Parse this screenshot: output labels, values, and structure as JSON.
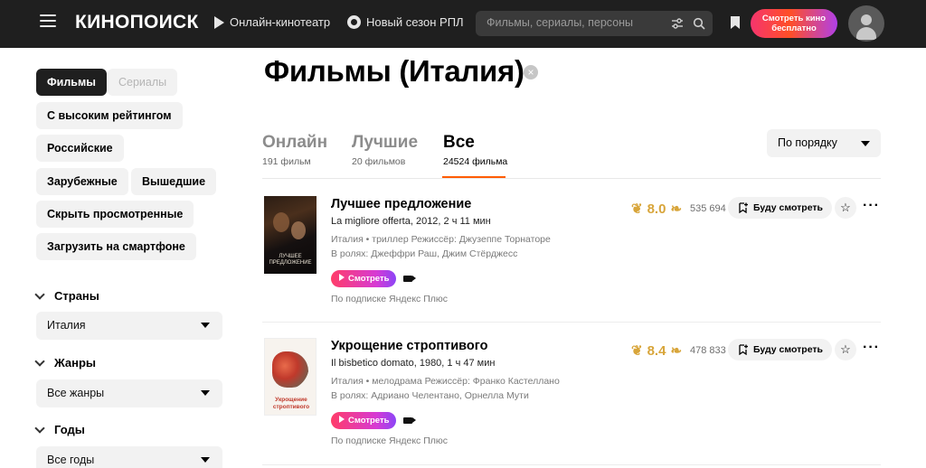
{
  "header": {
    "logo": "КИНОПОИСК",
    "nav": [
      {
        "label": "Онлайн-кинотеатр",
        "icon": "play-icon"
      },
      {
        "label": "Новый сезон РПЛ",
        "icon": "football-icon"
      }
    ],
    "search_placeholder": "Фильмы, сериалы, персоны",
    "cta_label": "Смотреть кино бесплатно",
    "colors": {
      "background": "#1f1f1f",
      "cta_gradient": [
        "#f5356e",
        "#ff4f26",
        "#b040e8"
      ]
    }
  },
  "sidebar": {
    "chips": [
      {
        "label": "Фильмы",
        "state": "active"
      },
      {
        "label": "Сериалы",
        "state": "disabled"
      },
      {
        "label": "С высоким рейтингом"
      },
      {
        "label": "Российские"
      },
      {
        "label": "Зарубежные"
      },
      {
        "label": "Вышедшие"
      },
      {
        "label": "Скрыть просмотренные"
      },
      {
        "label": "Загрузить на смартфоне"
      }
    ],
    "filters": [
      {
        "title": "Страны",
        "value": "Италия"
      },
      {
        "title": "Жанры",
        "value": "Все жанры"
      },
      {
        "title": "Годы",
        "value": "Все годы"
      }
    ]
  },
  "main": {
    "title": "Фильмы (Италия)",
    "tabs": [
      {
        "label": "Онлайн",
        "count": "191 фильм"
      },
      {
        "label": "Лучшие",
        "count": "20 фильмов"
      },
      {
        "label": "Все",
        "count": "24524 фильма",
        "active": true
      }
    ],
    "sort": "По порядку",
    "accent_color": "#ff5c00",
    "films": [
      {
        "title": "Лучшее предложение",
        "original": "La migliore offerta, 2012, 2 ч 11 мин",
        "meta": "Италия • триллер  Режиссёр: Джузеппе Торнаторе",
        "cast": "В ролях: Джеффри Раш, Джим Стёрджесс",
        "watch": "Смотреть",
        "subscription": "По подписке Яндекс Плюс",
        "rating": "8.0",
        "votes": "535 694",
        "want": "Буду смотреть",
        "poster_text": "ЛУЧШЕЕ ПРЕДЛОЖЕНИЕ"
      },
      {
        "title": "Укрощение строптивого",
        "original": "Il bisbetico domato, 1980, 1 ч 47 мин",
        "meta": "Италия • мелодрама  Режиссёр: Франко Кастеллано",
        "cast": "В ролях: Адриано Челентано, Орнелла Мути",
        "watch": "Смотреть",
        "subscription": "По подписке Яндекс Плюс",
        "rating": "8.4",
        "votes": "478 833",
        "want": "Буду смотреть",
        "poster_text": "Укрощение строптивого"
      }
    ]
  }
}
